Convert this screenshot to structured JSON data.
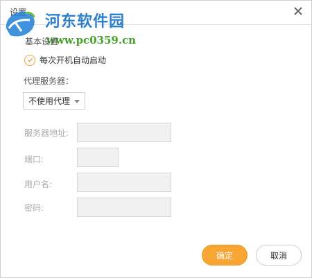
{
  "dialog": {
    "title": "设置"
  },
  "watermark": {
    "site_name": "河东软件园",
    "url": "www.pc0359.cn"
  },
  "basic": {
    "section_title": "基本设置",
    "autostart_label": "每次开机自动启动",
    "autostart_checked": true
  },
  "proxy": {
    "label": "代理服务器：",
    "selected": "不使用代理",
    "fields": {
      "server_label": "服务器地址:",
      "server_value": "",
      "port_label": "端口:",
      "port_value": "",
      "username_label": "用户名:",
      "username_value": "",
      "password_label": "密码:",
      "password_value": ""
    }
  },
  "buttons": {
    "ok": "确定",
    "cancel": "取消"
  },
  "colors": {
    "accent": "#f7a535",
    "check": "#f0a23a"
  }
}
